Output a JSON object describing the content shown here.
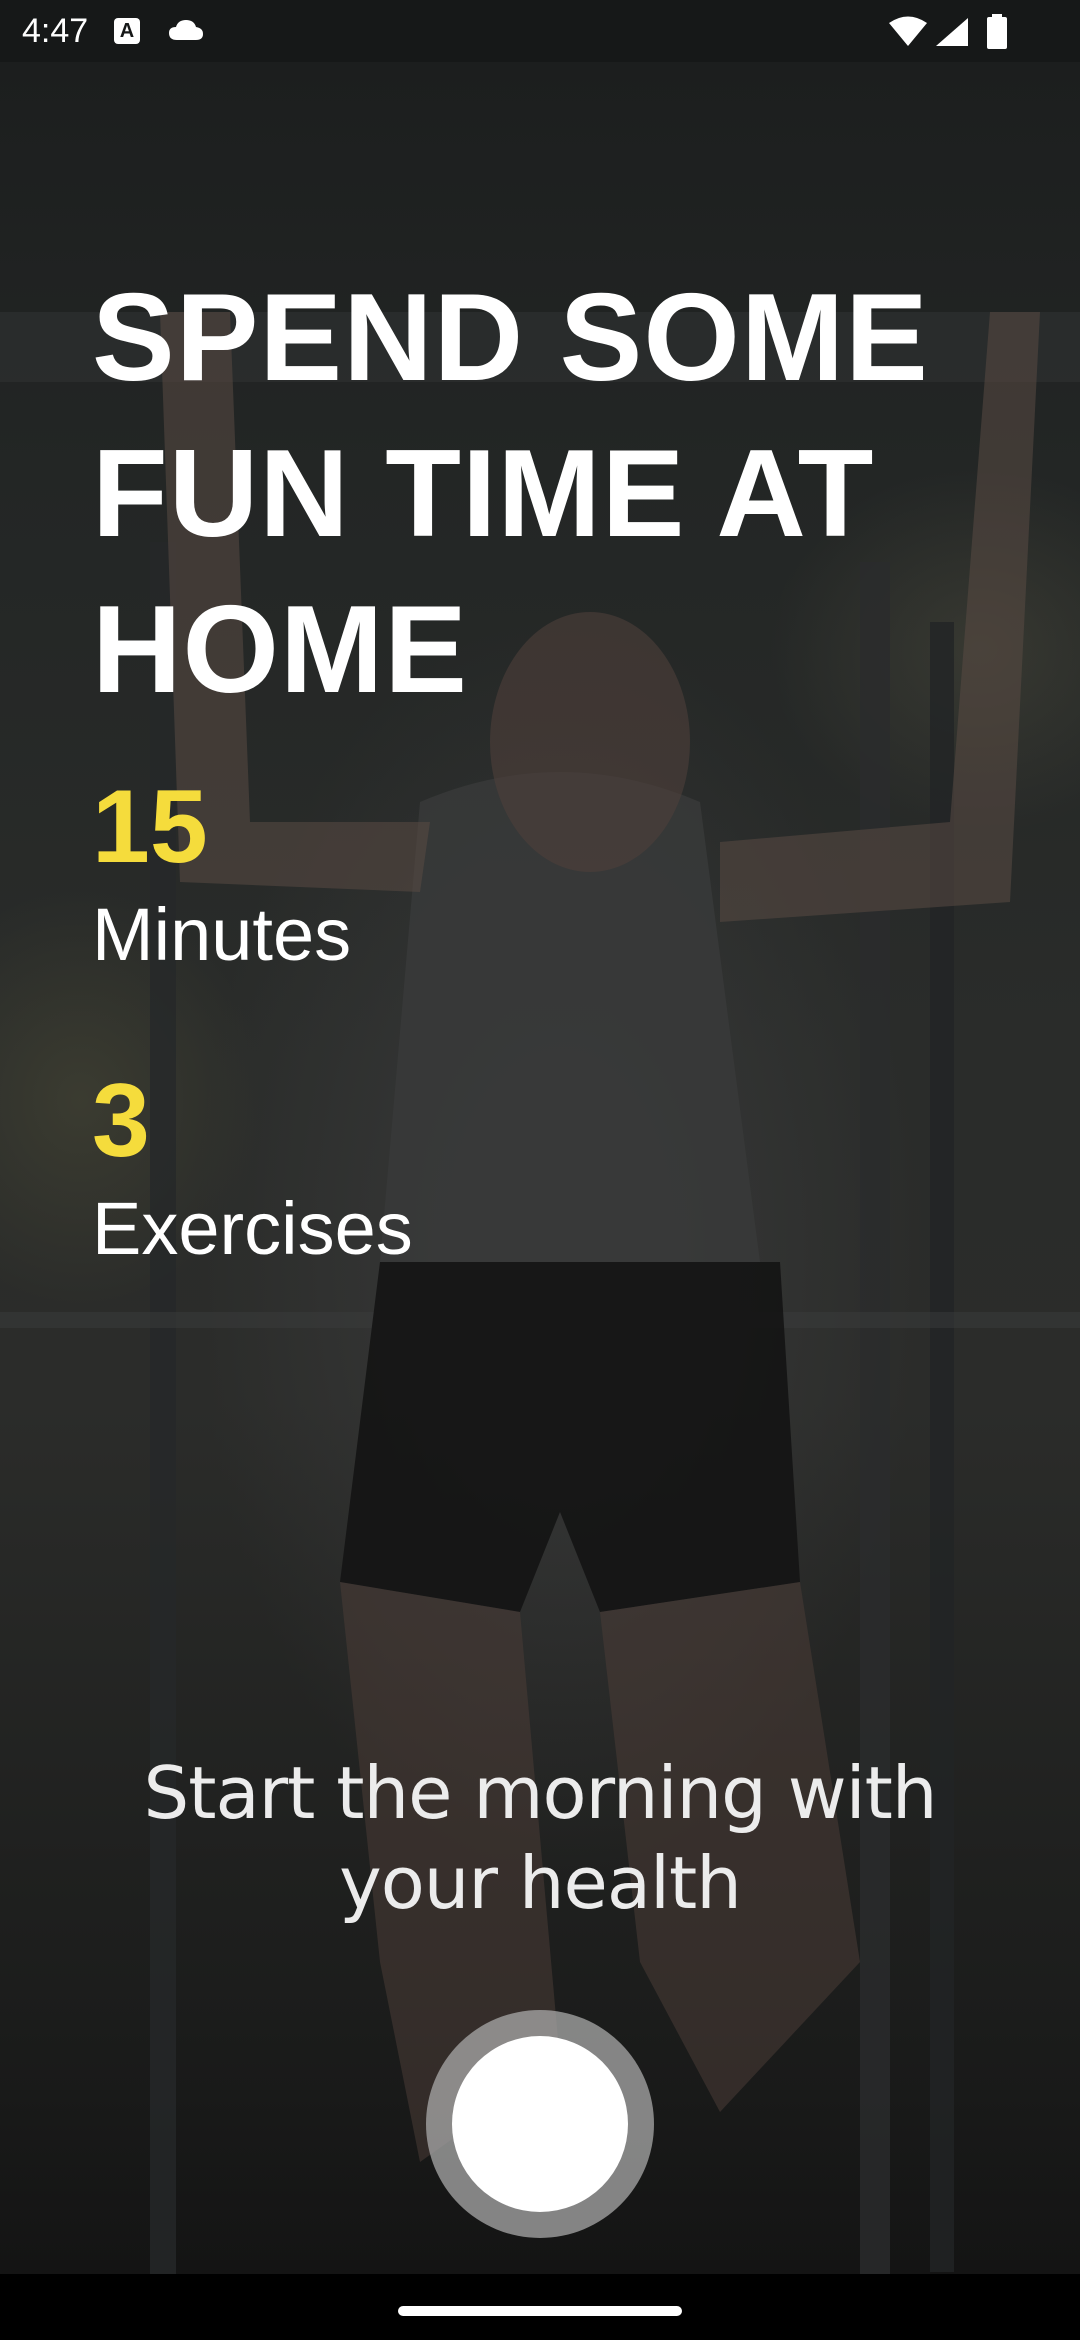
{
  "status_bar": {
    "time": "4:47",
    "notification_icons": [
      "text-a-icon",
      "cloud-icon"
    ],
    "system_icons": [
      "wifi-icon",
      "signal-icon",
      "battery-icon"
    ]
  },
  "hero": {
    "headline_lines": [
      "SPEND SOME",
      "FUN TIME AT",
      "HOME"
    ]
  },
  "stats": [
    {
      "value": "15",
      "label": "Minutes"
    },
    {
      "value": "3",
      "label": "Exercises"
    }
  ],
  "tagline": "Start the morning with your health",
  "start_button": {
    "icon": "record-circle-icon"
  },
  "colors": {
    "accent": "#f5dc3c",
    "text": "#ffffff",
    "button_ring": "#aaaaaa"
  }
}
